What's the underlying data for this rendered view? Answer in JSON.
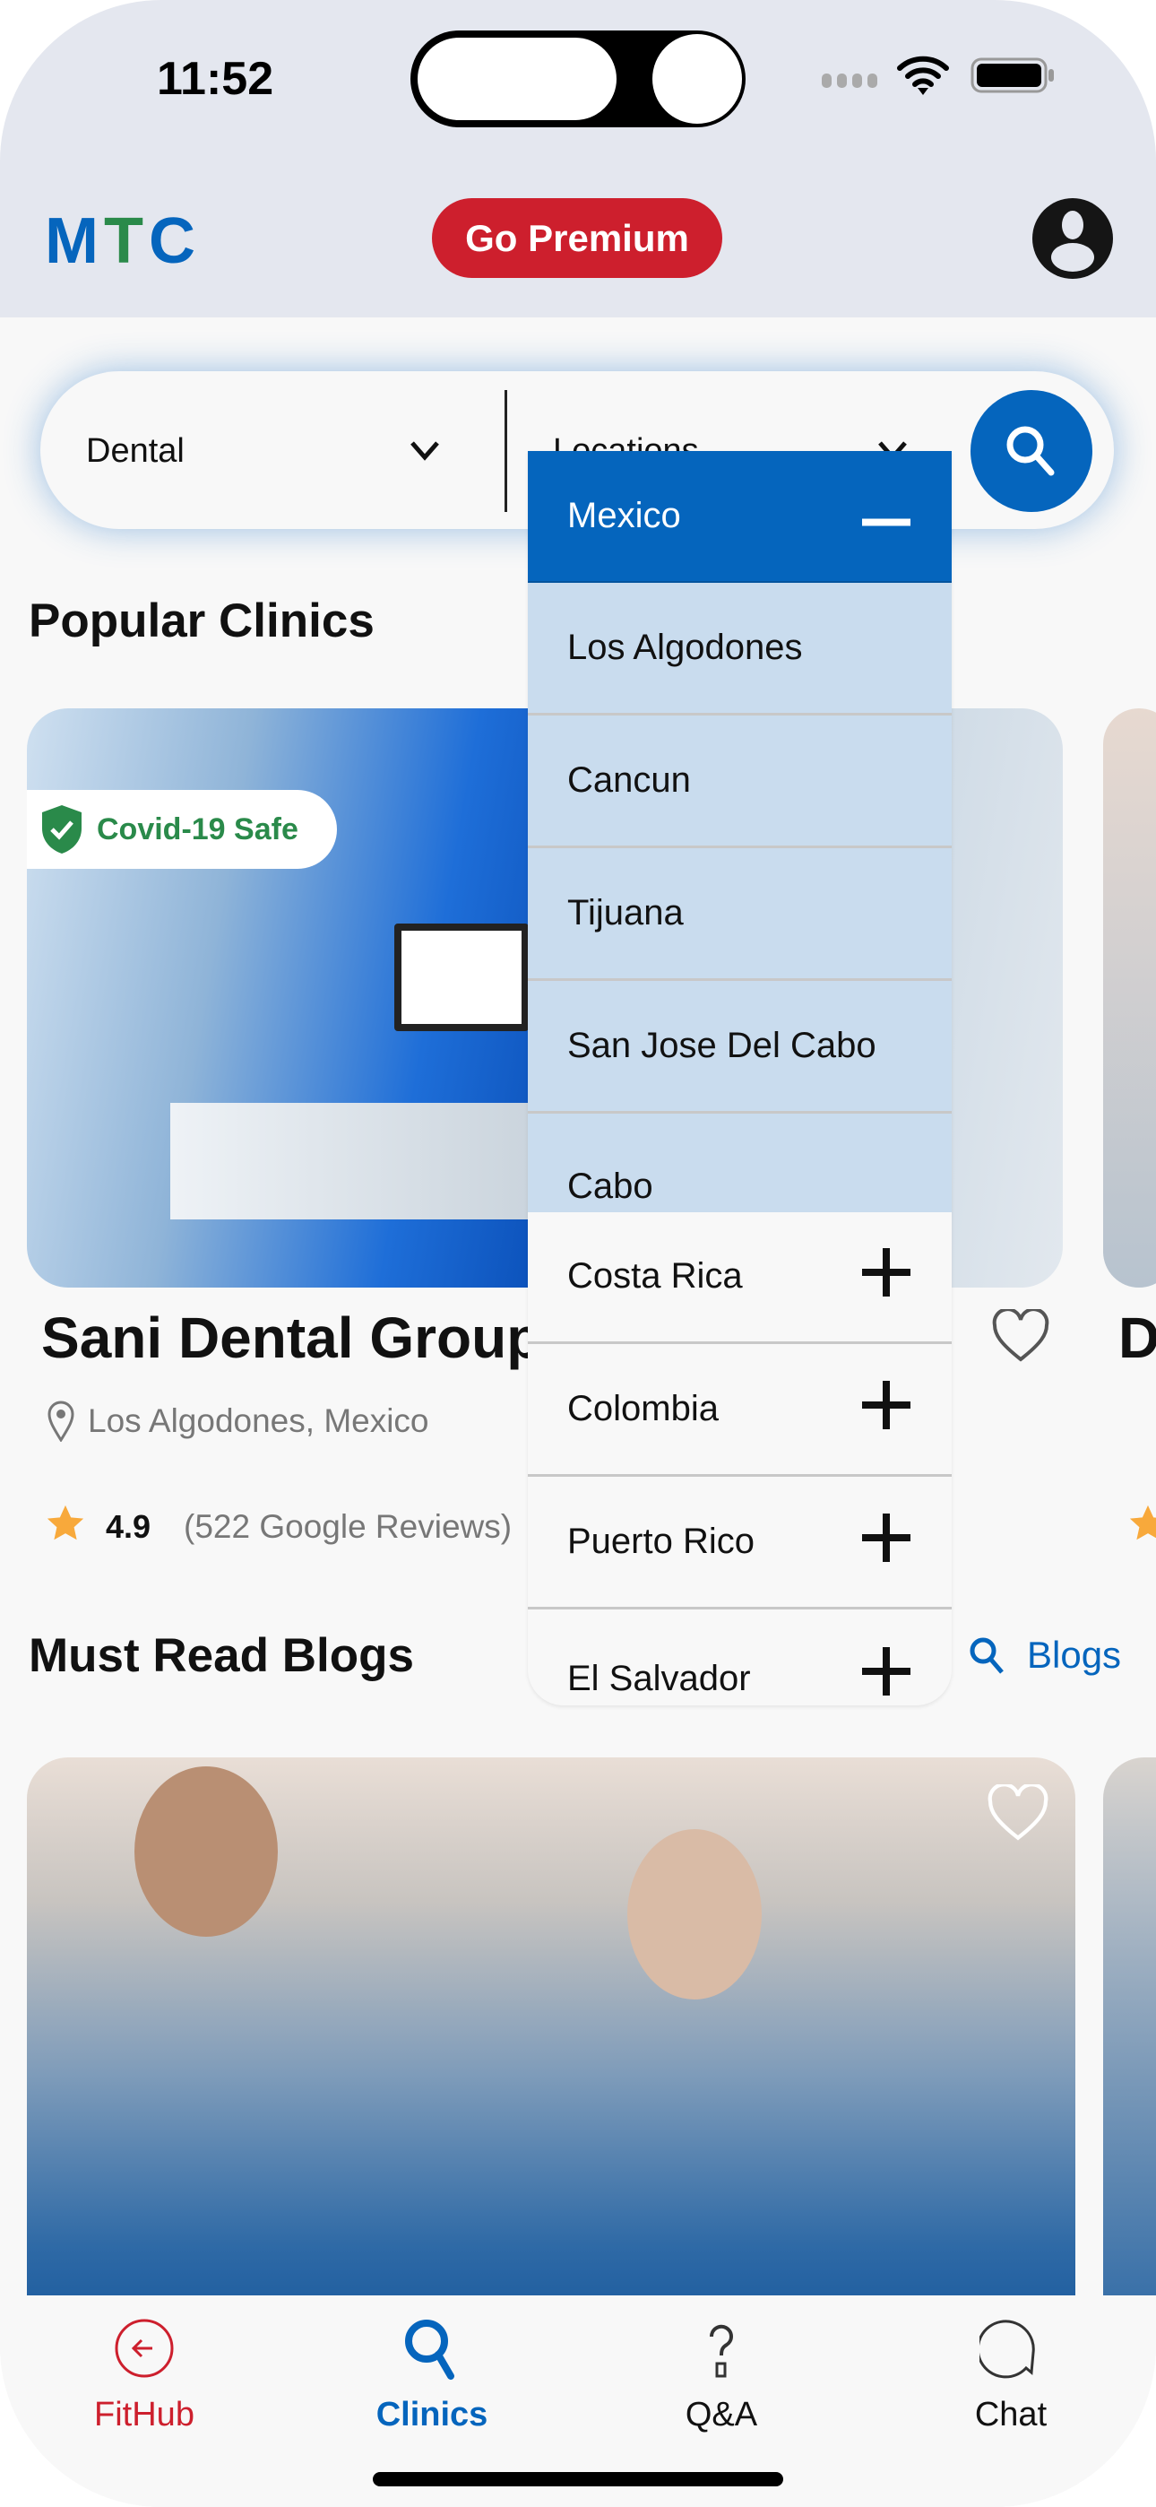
{
  "status_bar": {
    "time": "11:52"
  },
  "header": {
    "logo": [
      "M",
      "T",
      "C"
    ],
    "premium_label": "Go Premium"
  },
  "search": {
    "category": "Dental",
    "location_placeholder": "Locations"
  },
  "popular": {
    "title": "Popular Clinics",
    "clinic": {
      "badge": "Covid-19 Safe",
      "name": "Sani Dental Group",
      "location": "Los Algodones, Mexico",
      "rating": "4.9",
      "reviews": "(522 Google Reviews)"
    },
    "next_initial": "D"
  },
  "blogs": {
    "title": "Must Read Blogs",
    "link": "Blogs"
  },
  "dropdown": {
    "expanded": {
      "label": "Mexico",
      "cities": [
        "Los Algodones",
        "Cancun",
        "Tijuana",
        "San Jose Del Cabo",
        "Cabo"
      ]
    },
    "countries": [
      "Costa Rica",
      "Colombia",
      "Puerto Rico",
      "El Salvador"
    ]
  },
  "nav": [
    {
      "label": "FitHub",
      "color": "#cd1f2d"
    },
    {
      "label": "Clinics",
      "color": "#0565bd"
    },
    {
      "label": "Q&A",
      "color": "#111111"
    },
    {
      "label": "Chat",
      "color": "#111111"
    }
  ],
  "colors": {
    "brand_blue": "#0565bd",
    "brand_green": "#2a8a4a",
    "premium_red": "#cd1f2d"
  }
}
